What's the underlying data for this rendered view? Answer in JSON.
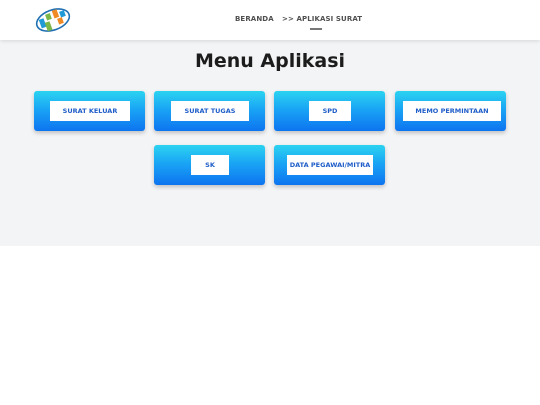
{
  "navbar": {
    "logo_name": "bps-logo",
    "links": [
      {
        "label": "BERANDA"
      },
      {
        "label": ">> APLIKASI SURAT"
      }
    ]
  },
  "main": {
    "title": "Menu Aplikasi",
    "menu_items": [
      {
        "label": "SURAT KELUAR"
      },
      {
        "label": "SURAT TUGAS"
      },
      {
        "label": "SPD"
      },
      {
        "label": "MEMO PERMINTAAN"
      },
      {
        "label": "SK"
      },
      {
        "label": "DATA PEGAWAI/MITRA"
      }
    ]
  },
  "colors": {
    "card_gradient_top": "#2bd3f0",
    "card_gradient_bottom": "#0d74f0",
    "card_text": "#1e5dc8",
    "background": "#f3f4f6"
  }
}
